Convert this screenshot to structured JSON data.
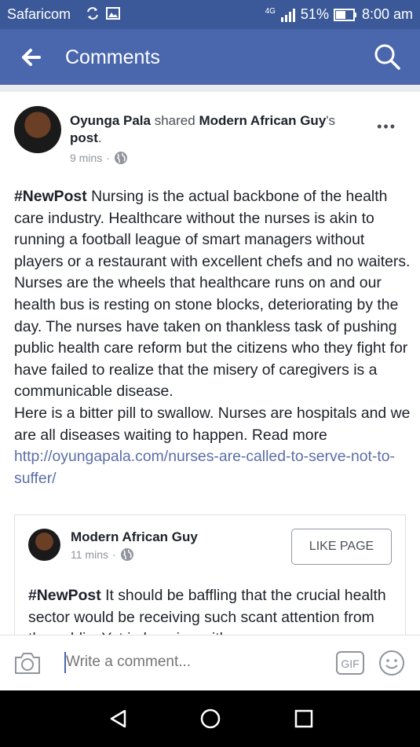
{
  "status_bar": {
    "carrier": "Safaricom",
    "network": "4G",
    "battery": "51%",
    "time": "8:00 am"
  },
  "app_bar": {
    "title": "Comments"
  },
  "post": {
    "author": "Oyunga Pala",
    "shared_text": "shared",
    "original_author": "Modern African Guy",
    "possessive": "'s",
    "post_word": "post",
    "period": ".",
    "time": "9 mins",
    "dot": "·",
    "hashtag": "#NewPost",
    "body": "Nursing is the actual backbone of the health care industry. Healthcare without the nurses is akin to running a football league of smart managers without players or a restaurant with excellent chefs and no waiters. Nurses are the wheels that healthcare runs on and our health bus is resting on stone blocks, deteriorating by the day. The nurses have taken on thankless task of pushing public health care reform but the citizens who they fight for have failed to realize that the misery of caregivers is a communicable disease.",
    "body2": "Here is a bitter pill to swallow. Nurses are hospitals and we are all diseases waiting to happen. Read more ",
    "link": "http://oyungapala.com/nurses-are-called-to-serve-not-to-suffer/",
    "more_label": "•••"
  },
  "shared_post": {
    "author": "Modern African Guy",
    "time": "11 mins",
    "dot": "·",
    "like_page_label": "LIKE PAGE",
    "hashtag": "#NewPost",
    "body": "It should be baffling that the crucial health sector would be receiving such scant attention from the public. Yet in keeping with"
  },
  "composer": {
    "placeholder": "Write a comment...",
    "gif_label": "GIF"
  }
}
